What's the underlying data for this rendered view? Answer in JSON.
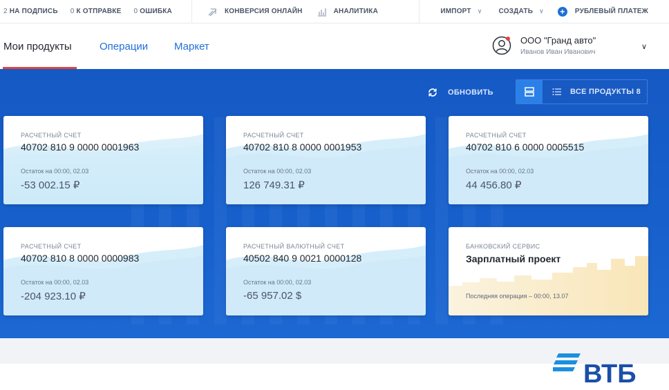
{
  "topbar": {
    "to_sign": {
      "count": "2",
      "label": "НА ПОДПИСЬ"
    },
    "to_send": {
      "count": "0",
      "label": "К ОТПРАВКЕ"
    },
    "errors": {
      "count": "0",
      "label": "ОШИБКА"
    },
    "conversion_label": "КОНВЕРСИЯ ОНЛАЙН",
    "analytics_label": "АНАЛИТИКА",
    "import_label": "ИМПОРТ",
    "create_label": "СОЗДАТЬ",
    "ruble_payment_label": "РУБЛЕВЫЙ ПЛАТЕЖ"
  },
  "nav": {
    "tabs": [
      {
        "label": "Мои продукты",
        "active": true
      },
      {
        "label": "Операции",
        "active": false
      },
      {
        "label": "Маркет",
        "active": false
      }
    ],
    "org": {
      "name": "ООО \"Гранд авто\"",
      "person": "Иванов Иван Иванович"
    }
  },
  "toolbar": {
    "refresh_label": "ОБНОВИТЬ",
    "all_products_label": "ВСЕ ПРОДУКТЫ 8"
  },
  "cards": [
    {
      "type": "РАСЧЕТНЫЙ СЧЕТ",
      "number": "40702 810 9 0000 0001963",
      "balance_label": "Остаток на 00:00, 02.03",
      "balance": "-53 002.15 ₽"
    },
    {
      "type": "РАСЧЕТНЫЙ СЧЕТ",
      "number": "40702 810 8 0000 0001953",
      "balance_label": "Остаток на 00:00, 02.03",
      "balance": "126 749.31 ₽"
    },
    {
      "type": "РАСЧЕТНЫЙ СЧЕТ",
      "number": "40702 810 6 0000 0005515",
      "balance_label": "Остаток на 00:00, 02.03",
      "balance": "44 456.80 ₽"
    },
    {
      "type": "РАСЧЕТНЫЙ СЧЕТ",
      "number": "40702 810 8 0000 0000983",
      "balance_label": "Остаток на 00:00, 02.03",
      "balance": "-204 923.10 ₽"
    },
    {
      "type": "РАСЧЕТНЫЙ ВАЛЮТНЫЙ СЧЕТ",
      "number": "40502 840 9 0021 0000128",
      "balance_label": "Остаток на 00:00, 02.03",
      "balance": "-65 957.02 $"
    }
  ],
  "service_card": {
    "type": "БАНКОВСКИЙ СЕРВИС",
    "title": "Зарплатный проект",
    "last_operation": "Последняя операция – 00:00, 13.07"
  },
  "logo": {
    "text": "ВТБ",
    "color": "#1a4fa8"
  },
  "colors": {
    "brand_blue": "#1559c4",
    "accent_red": "#e0433c",
    "link_blue": "#1f6fd6"
  }
}
